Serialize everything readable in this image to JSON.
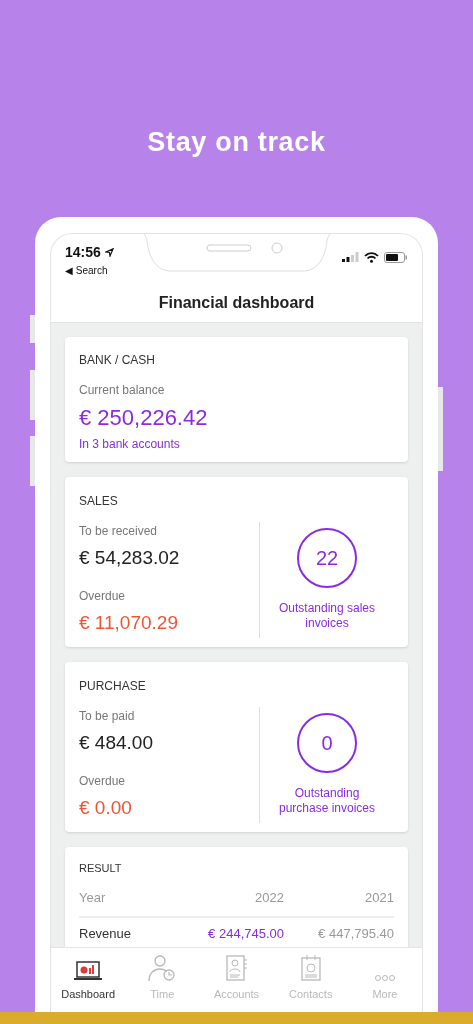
{
  "headline": "Stay on track",
  "status_bar": {
    "time": "14:56",
    "back": "◀ Search"
  },
  "title": "Financial dashboard",
  "bank": {
    "heading": "BANK / CASH",
    "label": "Current balance",
    "amount": "€ 250,226.42",
    "link": "In 3 bank accounts"
  },
  "summaries": [
    {
      "heading": "SALES",
      "due_label": "To be received",
      "due": "€ 54,283.02",
      "overdue_label": "Overdue",
      "overdue": "€ 11,070.29",
      "count": "22",
      "count_label": "Outstanding sales invoices"
    },
    {
      "heading": "PURCHASE",
      "due_label": "To be paid",
      "due": "€ 484.00",
      "overdue_label": "Overdue",
      "overdue": "€ 0.00",
      "count": "0",
      "count_label": "Outstanding purchase invoices"
    }
  ],
  "result": {
    "heading": "RESULT",
    "columns": [
      "Year",
      "2022",
      "2021"
    ],
    "rows": [
      {
        "label": "Revenue",
        "current": "€ 244,745.00",
        "previous": "€ 447,795.40"
      }
    ]
  },
  "tabs": [
    {
      "kind": "dashboard",
      "label": "Dashboard",
      "selected": true
    },
    {
      "kind": "time",
      "label": "Time",
      "selected": false
    },
    {
      "kind": "accounts",
      "label": "Accounts",
      "selected": false
    },
    {
      "kind": "contacts",
      "label": "Contacts",
      "selected": false
    },
    {
      "kind": "more",
      "label": "More",
      "selected": false
    }
  ]
}
